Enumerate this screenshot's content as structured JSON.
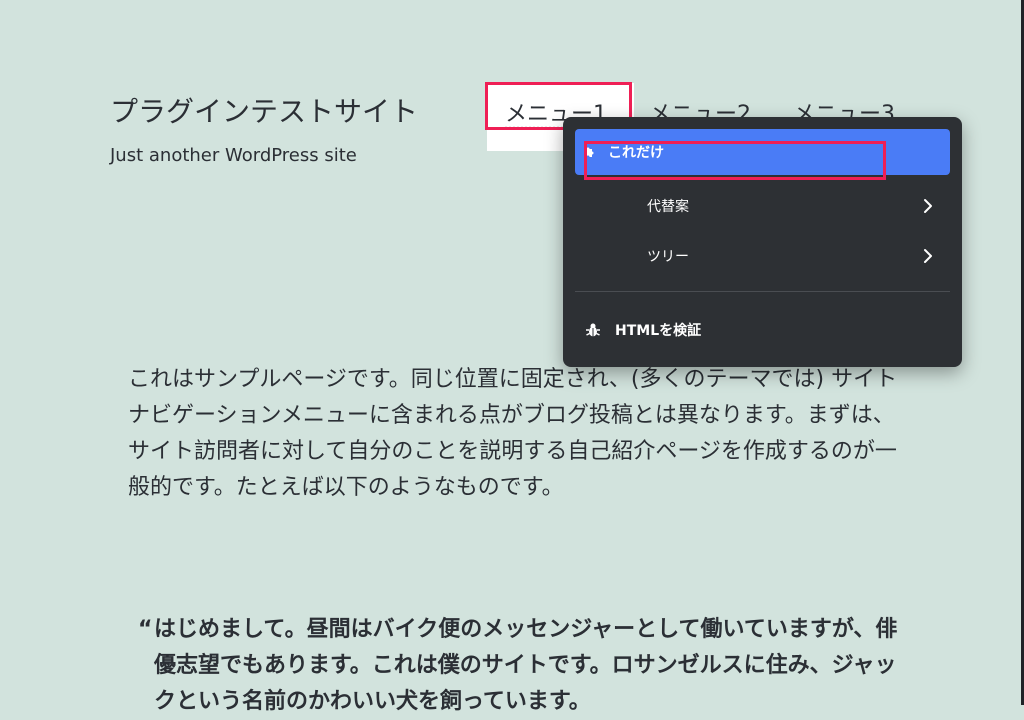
{
  "site": {
    "title": "プラグインテストサイト",
    "tagline": "Just another WordPress site"
  },
  "nav": {
    "items": [
      {
        "label": "メニュー1"
      },
      {
        "label": "メニュー2"
      },
      {
        "label": "メニュー3"
      }
    ]
  },
  "context_menu": {
    "items": [
      {
        "label": "これだけ",
        "icon": "puzzle-icon",
        "active": true
      },
      {
        "label": "代替案",
        "has_submenu": true
      },
      {
        "label": "ツリー",
        "has_submenu": true
      }
    ],
    "inspect": {
      "label": "HTMLを検証",
      "icon": "bug-icon"
    }
  },
  "content": {
    "paragraph": "これはサンプルページです。同じ位置に固定され、(多くのテーマでは) サイトナビゲーションメニューに含まれる点がブログ投稿とは異なります。まずは、サイト訪問者に対して自分のことを説明する自己紹介ページを作成するのが一般的です。たとえば以下のようなものです。",
    "quote_mark": "“",
    "quote": "はじめまして。昼間はバイク便のメッセンジャーとして働いていますが、俳優志望でもあります。これは僕のサイトです。ロサンゼルスに住み、ジャックという名前のかわいい犬を飼っています。"
  },
  "colors": {
    "background": "#d2e3dd",
    "menu_bg": "#2d3034",
    "menu_active": "#4a7cf6",
    "highlight_outline": "#ef1f55"
  }
}
